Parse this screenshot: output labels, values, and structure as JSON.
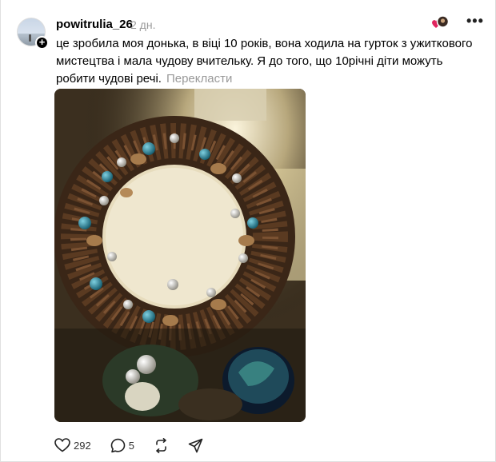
{
  "post": {
    "username": "powitrulia_26",
    "time": "2 дн.",
    "text": "це зробила моя донька, в віці 10 років, вона ходила на гурток з ужиткового мистецтва і мала чудову вчительку. Я до того, що 10річні діти можуть робити чудові речі.",
    "translate_label": "Перекласти",
    "more_label": "•••",
    "follow_icon_label": "+",
    "image": "photo of a handmade Christmas wreath made of pine cones, nuts, cinnamon sticks and baubles"
  },
  "actions": {
    "likes_count": "292",
    "comments_count": "5"
  },
  "icons": {
    "like": "heart-icon",
    "comment": "comment-icon",
    "repost": "repost-icon",
    "share": "share-icon",
    "reaction": "heart-avatar-reaction-icon",
    "more": "more-icon"
  },
  "colors": {
    "muted_text": "#999999",
    "card_bg": "#ffffff"
  }
}
